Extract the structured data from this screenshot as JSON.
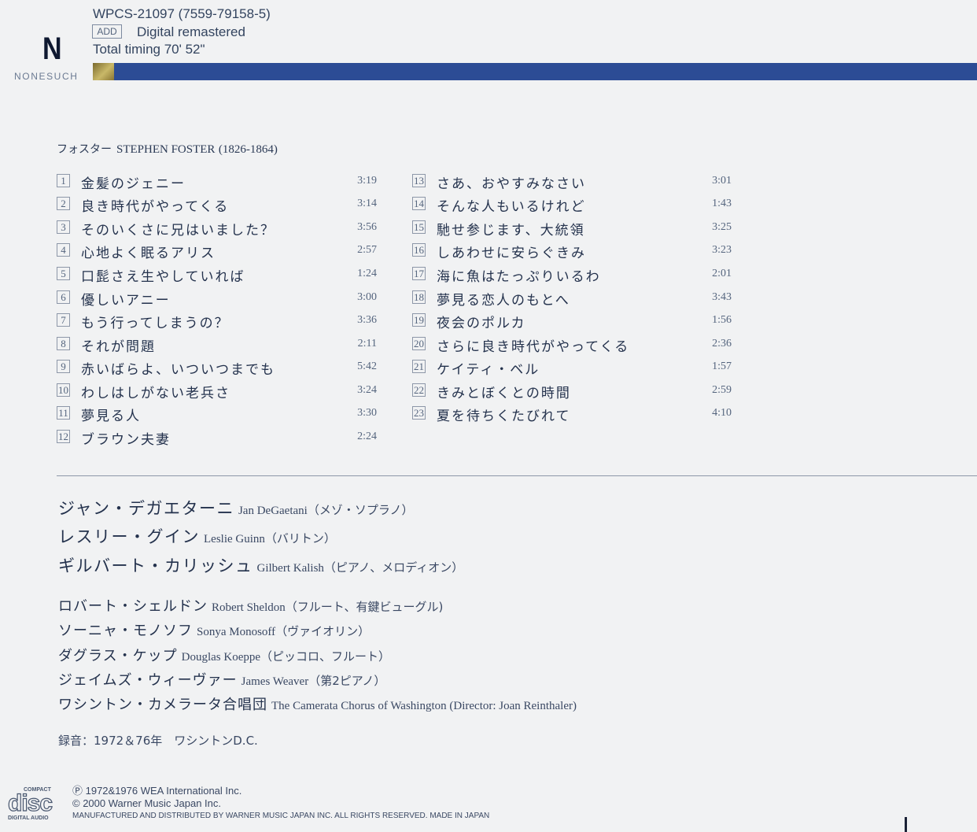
{
  "header": {
    "logo_letter": "N",
    "logo_word": "NONESUCH",
    "catalog": "WPCS-21097 (7559-79158-5)",
    "add_badge": "ADD",
    "remastered": "Digital remastered",
    "timing": "Total timing 70' 52\""
  },
  "composer": {
    "ja": "フォスター",
    "en": "STEPHEN FOSTER",
    "years": "(1826-1864)"
  },
  "tracks_left": [
    {
      "num": "1",
      "title": "金髪のジェニー",
      "time": "3:19"
    },
    {
      "num": "2",
      "title": "良き時代がやってくる",
      "time": "3:14"
    },
    {
      "num": "3",
      "title": "そのいくさに兄はいました？",
      "time": "3:56"
    },
    {
      "num": "4",
      "title": "心地よく眠るアリス",
      "time": "2:57"
    },
    {
      "num": "5",
      "title": "口髭さえ生やしていれば",
      "time": "1:24"
    },
    {
      "num": "6",
      "title": "優しいアニー",
      "time": "3:00"
    },
    {
      "num": "7",
      "title": "もう行ってしまうの？",
      "time": "3:36"
    },
    {
      "num": "8",
      "title": "それが問題",
      "time": "2:11"
    },
    {
      "num": "9",
      "title": "赤いばらよ、いついつまでも",
      "time": "5:42"
    },
    {
      "num": "10",
      "title": "わしはしがない老兵さ",
      "time": "3:24"
    },
    {
      "num": "11",
      "title": "夢見る人",
      "time": "3:30"
    },
    {
      "num": "12",
      "title": "ブラウン夫妻",
      "time": "2:24"
    }
  ],
  "tracks_right": [
    {
      "num": "13",
      "title": "さあ、おやすみなさい",
      "time": "3:01"
    },
    {
      "num": "14",
      "title": "そんな人もいるけれど",
      "time": "1:43"
    },
    {
      "num": "15",
      "title": "馳せ参じます、大統領",
      "time": "3:25"
    },
    {
      "num": "16",
      "title": "しあわせに安らぐきみ",
      "time": "3:23"
    },
    {
      "num": "17",
      "title": "海に魚はたっぷりいるわ",
      "time": "2:01"
    },
    {
      "num": "18",
      "title": "夢見る恋人のもとへ",
      "time": "3:43"
    },
    {
      "num": "19",
      "title": "夜会のポルカ",
      "time": "1:56"
    },
    {
      "num": "20",
      "title": "さらに良き時代がやってくる",
      "time": "2:36"
    },
    {
      "num": "21",
      "title": "ケイティ・ベル",
      "time": "1:57"
    },
    {
      "num": "22",
      "title": "きみとぼくとの時間",
      "time": "2:59"
    },
    {
      "num": "23",
      "title": "夏を待ちくたびれて",
      "time": "4:10"
    }
  ],
  "performers_main": [
    {
      "ja": "ジャン・デガエターニ",
      "en": "Jan DeGaetani",
      "role": "（メゾ・ソプラノ）"
    },
    {
      "ja": "レスリー・グイン",
      "en": "Leslie Guinn",
      "role": "（バリトン）"
    },
    {
      "ja": "ギルバート・カリッシュ",
      "en": "Gilbert Kalish",
      "role": "（ピアノ、メロディオン）"
    }
  ],
  "performers_other": [
    {
      "ja": "ロバート・シェルドン",
      "en": "Robert Sheldon",
      "role": "（フルート、有鍵ビューグル)"
    },
    {
      "ja": "ソーニャ・モノソフ",
      "en": "Sonya Monosoff",
      "role": "（ヴァイオリン）"
    },
    {
      "ja": "ダグラス・ケップ",
      "en": "Douglas Koeppe",
      "role": "（ピッコロ、フルート）"
    },
    {
      "ja": "ジェイムズ・ウィーヴァー",
      "en": "James Weaver",
      "role": "（第2ピアノ）"
    },
    {
      "ja": "ワシントン・カメラータ合唱団",
      "en": "The Camerata Chorus of Washington (Director: Joan Reinthaler)",
      "role": ""
    }
  ],
  "recording": "録音：1972＆76年　ワシントンD.C.",
  "footer": {
    "disc_top": "COMPACT",
    "disc_mid": "disc",
    "disc_bottom": "DIGITAL AUDIO",
    "p_line": "Ⓟ 1972&1976 WEA International Inc.",
    "c_line": "© 2000 Warner Music Japan Inc.",
    "manufactured": "MANUFACTURED AND DISTRIBUTED BY WARNER MUSIC JAPAN INC. ALL RIGHTS RESERVED. MADE IN JAPAN"
  }
}
